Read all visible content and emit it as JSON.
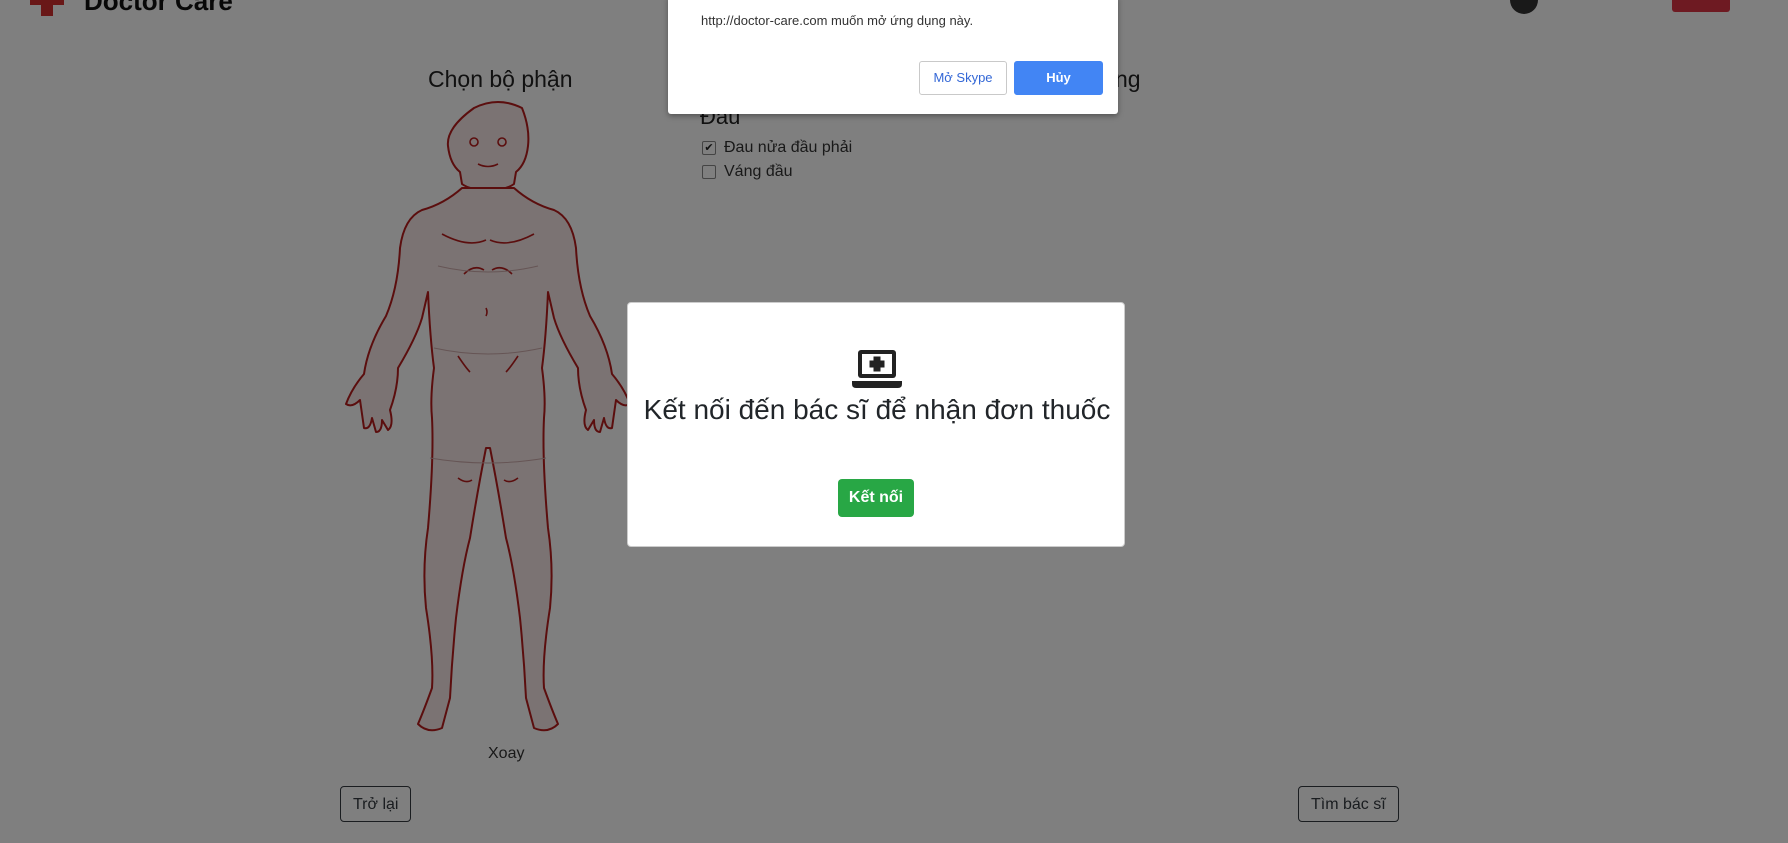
{
  "header": {
    "brand": "Doctor Care"
  },
  "left_panel": {
    "title": "Chọn bộ phận",
    "rotate_label": "Xoay"
  },
  "right_panel": {
    "title_visible": "ng",
    "group_title": "Đau",
    "symptoms": [
      {
        "label": "Đau nửa đầu phải",
        "checked": true
      },
      {
        "label": "Váng đầu",
        "checked": false
      }
    ]
  },
  "footer": {
    "back_label": "Trở lại",
    "find_doctor_label": "Tìm bác sĩ"
  },
  "modal": {
    "icon": "laptop-medical-icon",
    "title": "Kết nối đến bác sĩ để nhận đơn thuốc",
    "connect_label": "Kết nối"
  },
  "browser_dialog": {
    "message": "http://doctor-care.com muốn mở ứng dụng này.",
    "open_skype_label": "Mở Skype",
    "cancel_label": "Hủy"
  },
  "colors": {
    "overlay": "#000000",
    "success": "#28a745",
    "dialog_primary": "#4285f4",
    "body_outline": "#b71c1c"
  }
}
